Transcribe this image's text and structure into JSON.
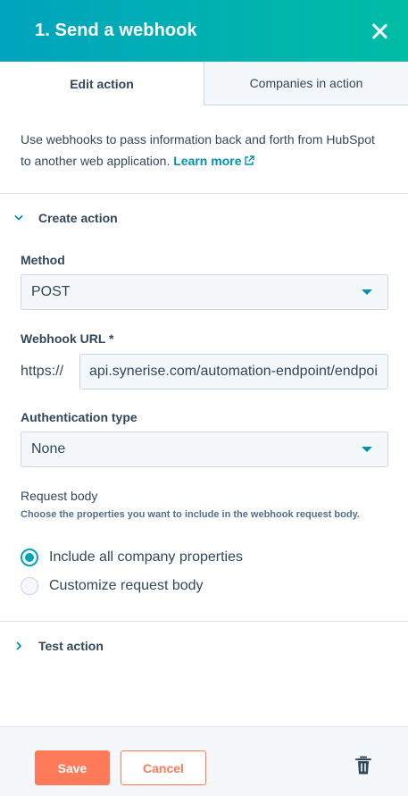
{
  "panel": {
    "title": "1. Send a webhook",
    "close_icon": "close-icon"
  },
  "tabs": [
    {
      "label": "Edit action",
      "active": true
    },
    {
      "label": "Companies in action",
      "active": false
    }
  ],
  "intro": {
    "text": "Use webhooks to pass information back and forth from HubSpot to another web application.",
    "link_label": "Learn more",
    "link_icon": "external-link-icon"
  },
  "create_section": {
    "label": "Create action",
    "expanded": true,
    "method": {
      "label": "Method",
      "value": "POST"
    },
    "webhook_url": {
      "label": "Webhook URL *",
      "prefix": "https://",
      "value": "api.synerise.com/automation-endpoint/endpoint"
    },
    "auth": {
      "label": "Authentication type",
      "value": "None"
    },
    "request_body": {
      "label": "Request body",
      "help": "Choose the properties you want to include in the webhook request body.",
      "options": [
        {
          "label": "Include all company properties",
          "checked": true
        },
        {
          "label": "Customize request body",
          "checked": false
        }
      ]
    }
  },
  "test_section": {
    "label": "Test action",
    "expanded": false
  },
  "footer": {
    "save_label": "Save",
    "cancel_label": "Cancel",
    "delete_icon": "trash-icon"
  },
  "colors": {
    "header_gradient_start": "#00a4bd",
    "header_gradient_end": "#00bda5",
    "link": "#0091ae",
    "primary_button": "#ff7a59",
    "text": "#33475b"
  }
}
